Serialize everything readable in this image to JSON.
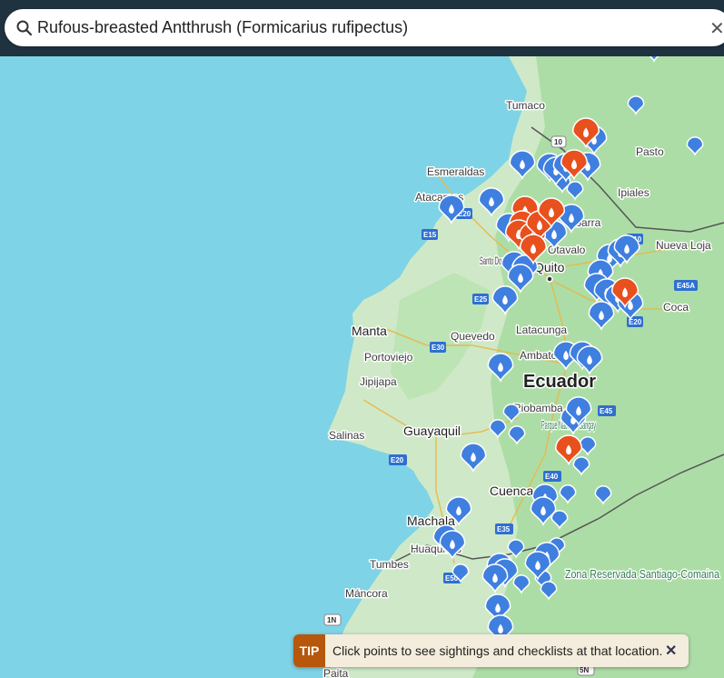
{
  "search": {
    "query": "Rufous-breasted Antthrush (Formicarius rufipectus)",
    "icon": "search-icon",
    "clear_icon": "close-icon",
    "clear_glyph": "✕"
  },
  "colors": {
    "ocean": "#7fd3e6",
    "land": "#cfe9c8",
    "forest": "#9fd79a",
    "topbar": "#1f3240",
    "marker_blue": "#3f7fe0",
    "marker_red": "#e8501e",
    "tip_badge": "#b6570b",
    "tip_bg": "#f4ecdc"
  },
  "map": {
    "country_label": "Ecuador",
    "cities": [
      "Guayaquil",
      "Quito",
      "Cuenca",
      "Machala",
      "Manta",
      "Esmeraldas",
      "Pasto",
      "Tumbes"
    ],
    "towns": [
      "Tumaco",
      "Atacames",
      "Ipiales",
      "Nueva Loja",
      "Coca",
      "Santo Domingo",
      "Latacunga",
      "Quevedo",
      "Portoviejo",
      "Jipijapa",
      "Ambato",
      "Riobamba",
      "Salinas",
      "Huaquillas",
      "Máncora",
      "Paita",
      "Otavalo",
      "Ibarra"
    ],
    "parks": [
      "Parque Nacional Sangay",
      "Zona Reservada Santiago-Comaina"
    ],
    "routes": [
      "10",
      "E20",
      "E15",
      "E25",
      "E30",
      "E10",
      "E45A",
      "E45",
      "E40",
      "E35",
      "E50",
      "E20",
      "1N",
      "5N",
      "E20"
    ],
    "markers_blue": "many",
    "markers_red": "several"
  },
  "tip": {
    "badge": "TIP",
    "message": "Click points to see sightings and checklists at that location.",
    "close_glyph": "✕"
  }
}
